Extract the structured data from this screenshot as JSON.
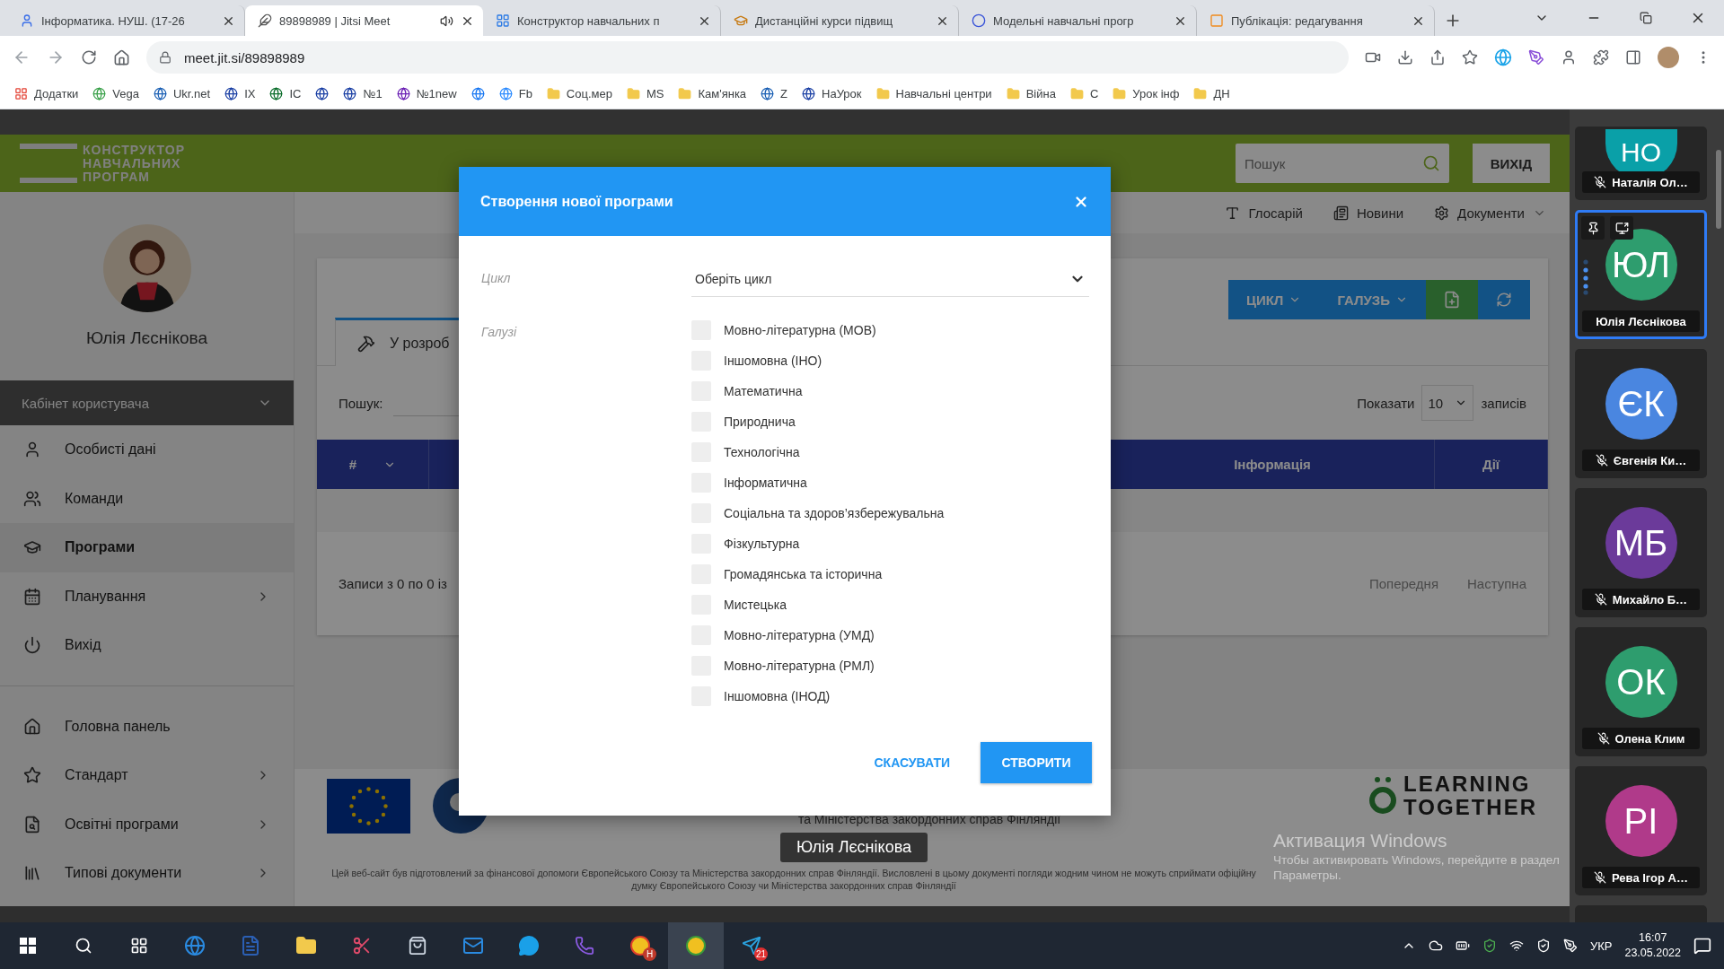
{
  "browser": {
    "tabs": [
      {
        "title": "Інформатика. НУШ. (17-26",
        "selected": false,
        "audio": false
      },
      {
        "title": "89898989 | Jitsi Meet",
        "selected": true,
        "audio": true
      },
      {
        "title": "Конструктор навчальних п",
        "selected": false,
        "audio": false
      },
      {
        "title": "Дистанційні курси підвищ",
        "selected": false,
        "audio": false
      },
      {
        "title": "Модельні навчальні прогр",
        "selected": false,
        "audio": false
      },
      {
        "title": "Публікація: редагування",
        "selected": false,
        "audio": false
      }
    ],
    "url": "meet.jit.si/89898989",
    "bookmarks": [
      {
        "label": "Додатки",
        "kind": "apps"
      },
      {
        "label": "Vega",
        "kind": "site"
      },
      {
        "label": "Ukr.net",
        "kind": "site"
      },
      {
        "label": "IX",
        "kind": "site"
      },
      {
        "label": "IC",
        "kind": "site"
      },
      {
        "kind": "site"
      },
      {
        "label": "№1",
        "kind": "site"
      },
      {
        "label": "№1new",
        "kind": "site"
      },
      {
        "kind": "site"
      },
      {
        "label": "Fb",
        "kind": "site"
      },
      {
        "label": "Соц.мер",
        "kind": "folder"
      },
      {
        "label": "MS",
        "kind": "folder"
      },
      {
        "label": "Кам'янка",
        "kind": "folder"
      },
      {
        "label": "Z",
        "kind": "site"
      },
      {
        "label": "НаУрок",
        "kind": "site"
      },
      {
        "label": "Навчальні центри",
        "kind": "folder"
      },
      {
        "label": "Війна",
        "kind": "folder"
      },
      {
        "label": "С",
        "kind": "folder"
      },
      {
        "label": "Урок інф",
        "kind": "folder"
      },
      {
        "label": "ДН",
        "kind": "folder"
      }
    ]
  },
  "site": {
    "logo_lines": [
      "КОНСТРУКТОР",
      "НАВЧАЛЬНИХ",
      "ПРОГРАМ"
    ],
    "search_placeholder": "Пошук",
    "exit": "ВИХІД",
    "user": "Юлія Лєснікова",
    "menu_title": "Кабінет користувача",
    "menu": [
      {
        "label": "Особисті дані",
        "selected": false,
        "submenu": false
      },
      {
        "label": "Команди",
        "selected": false,
        "submenu": false
      },
      {
        "label": "Програми",
        "selected": true,
        "submenu": false
      },
      {
        "label": "Планування",
        "selected": false,
        "submenu": true
      },
      {
        "label": "Вихід",
        "selected": false,
        "submenu": false
      }
    ],
    "nav": [
      {
        "label": "Головна панель",
        "selected": false,
        "submenu": false
      },
      {
        "label": "Стандарт",
        "selected": false,
        "submenu": true
      },
      {
        "label": "Освітні програми",
        "selected": false,
        "submenu": true
      },
      {
        "label": "Типові документи",
        "selected": false,
        "submenu": true
      }
    ],
    "links": [
      "Глосарій",
      "Новини",
      "Документи"
    ],
    "tab": "У розроб",
    "filters": [
      "ЦИКЛ",
      "ГАЛУЗЬ"
    ],
    "search_label": "Пошук:",
    "page_size_label": "Показати",
    "page_size": "10",
    "page_size_suffix": "записів",
    "columns": [
      "#",
      "Інформація",
      "Дії"
    ],
    "records": "Записи з 0 по 0 із",
    "pager": [
      "Попередня",
      "Наступна"
    ],
    "partner_line": "та Міністерства закордонних справ Фінляндії",
    "partner_logo": [
      "LEARNING",
      "TOGETHER"
    ],
    "disclaimer": "Цей веб-сайт був підготовлений за фінансової допомоги Європейського Союзу та Міністерства закордонних справ Фінляндії. Висловлені в цьому документі погляди жодним чином не можуть сприймати офіційну думку Європейського Союзу чи Міністерства закордонних справ Фінляндії"
  },
  "dialog": {
    "title": "Створення нової програми",
    "cycle_label": "Цикл",
    "cycle_placeholder": "Оберіть цикл",
    "branches_label": "Галузі",
    "branches": [
      {
        "label": "Мовно-літературна (МОВ)",
        "checked": false
      },
      {
        "label": "Іншомовна (ІНО)",
        "checked": false
      },
      {
        "label": "Математична",
        "checked": false
      },
      {
        "label": "Природнича",
        "checked": false
      },
      {
        "label": "Технологічна",
        "checked": false
      },
      {
        "label": "Інформатична",
        "checked": false
      },
      {
        "label": "Соціальна та здоров’язбережувальна",
        "checked": false
      },
      {
        "label": "Фізкультурна",
        "checked": false
      },
      {
        "label": "Громадянська та історична",
        "checked": false
      },
      {
        "label": "Мистецька",
        "checked": false
      },
      {
        "label": "Мовно-літературна (УМД)",
        "checked": false
      },
      {
        "label": "Мовно-літературна (РМЛ)",
        "checked": false
      },
      {
        "label": "Іншомовна (ІНОД)",
        "checked": false
      }
    ],
    "cancel": "СКАСУВАТИ",
    "create": "СТВОРИТИ"
  },
  "tooltip": "Юлія Лєснікова",
  "windows_notice": {
    "title": "Активация Windows",
    "text": "Чтобы активировать Windows, перейдите в раздел",
    "link": "Параметры."
  },
  "participants": [
    {
      "initials": "НО",
      "name": "Наталія Ол…",
      "color": "#0aa0a8",
      "muted": true,
      "selected": false
    },
    {
      "initials": "ЮЛ",
      "name": "Юлія Лєснікова",
      "color": "#2e9d6e",
      "muted": false,
      "selected": true
    },
    {
      "initials": "ЄК",
      "name": "Євгенія Ки…",
      "color": "#4a86e0",
      "muted": true,
      "selected": false
    },
    {
      "initials": "МБ",
      "name": "Михайло Б…",
      "color": "#6b3a9a",
      "muted": true,
      "selected": false
    },
    {
      "initials": "ОК",
      "name": "Олена Клим",
      "color": "#2e9d6e",
      "muted": true,
      "selected": false
    },
    {
      "initials": "РІ",
      "name": "Рева Ігор А…",
      "color": "#b03a8a",
      "muted": true,
      "selected": false
    }
  ],
  "taskbar": {
    "chrome_badge": "Н",
    "telegram_badge": "21",
    "language": "УКР",
    "time": "16:07",
    "date": "23.05.2022"
  }
}
